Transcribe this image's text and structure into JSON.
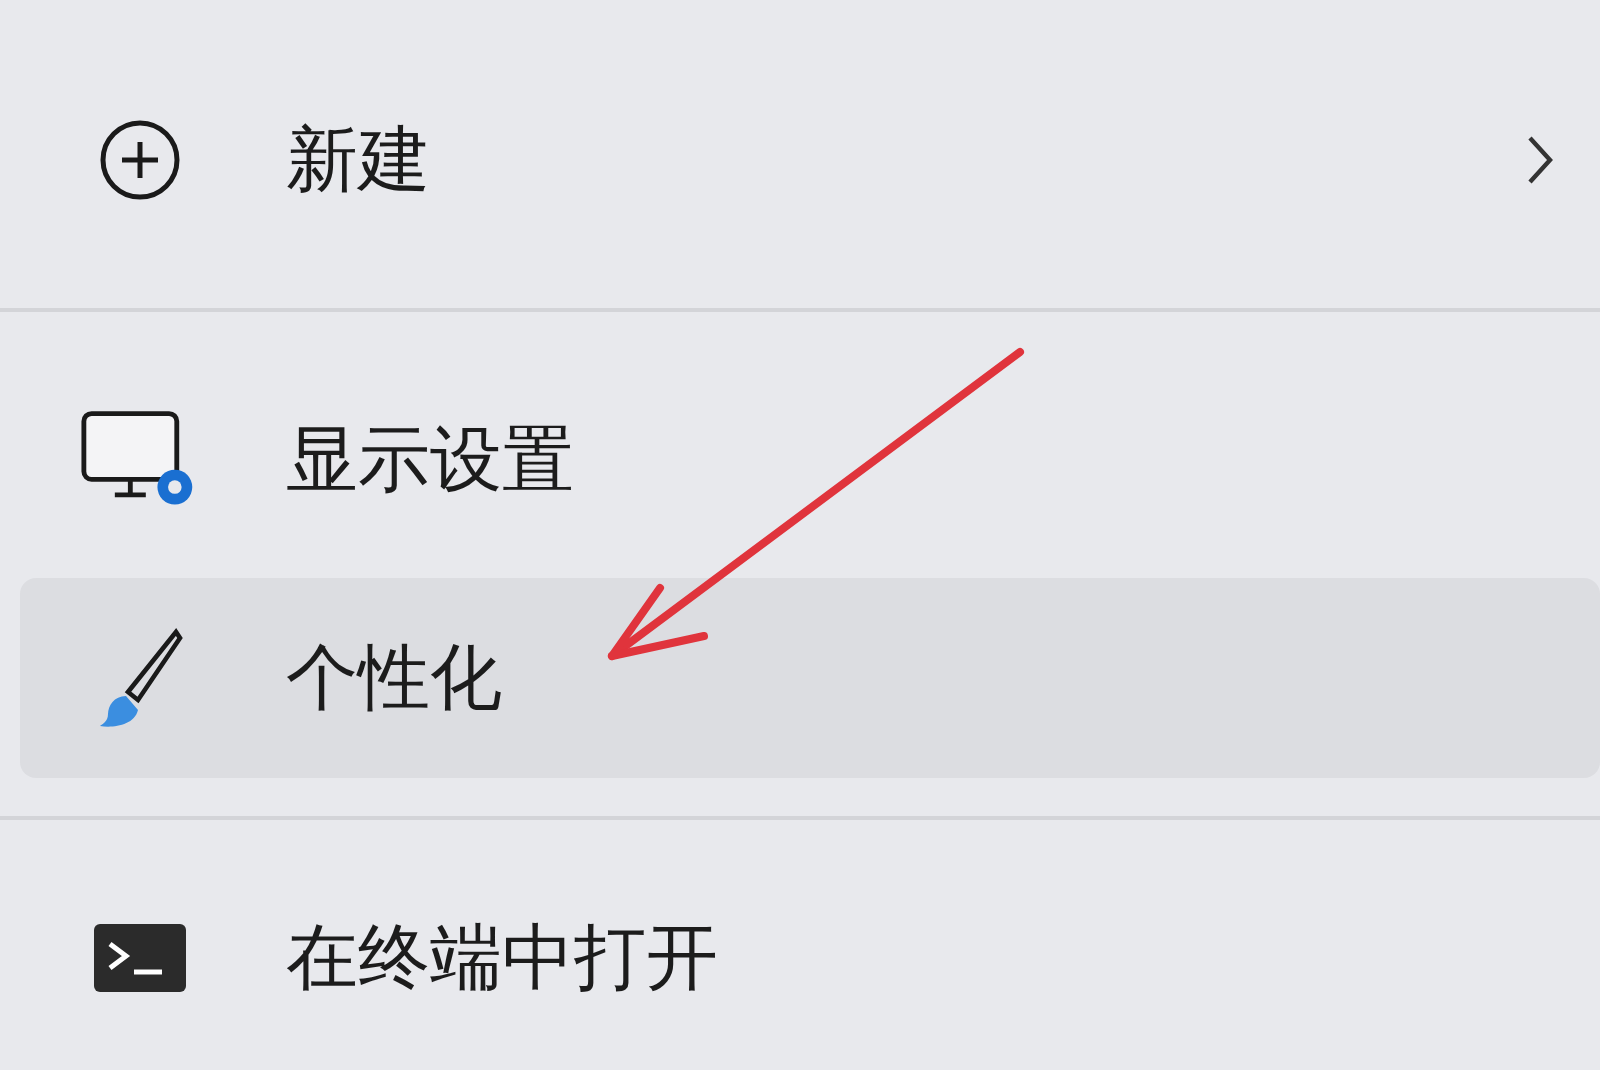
{
  "menu": {
    "items": [
      {
        "kind": "item",
        "label": "新建",
        "submenu": true,
        "selected": false
      },
      {
        "kind": "divider"
      },
      {
        "kind": "item",
        "label": "显示设置",
        "submenu": false,
        "selected": false
      },
      {
        "kind": "item",
        "label": "个性化",
        "submenu": false,
        "selected": true
      },
      {
        "kind": "divider"
      },
      {
        "kind": "item",
        "label": "在终端中打开",
        "submenu": false,
        "selected": false
      }
    ]
  }
}
